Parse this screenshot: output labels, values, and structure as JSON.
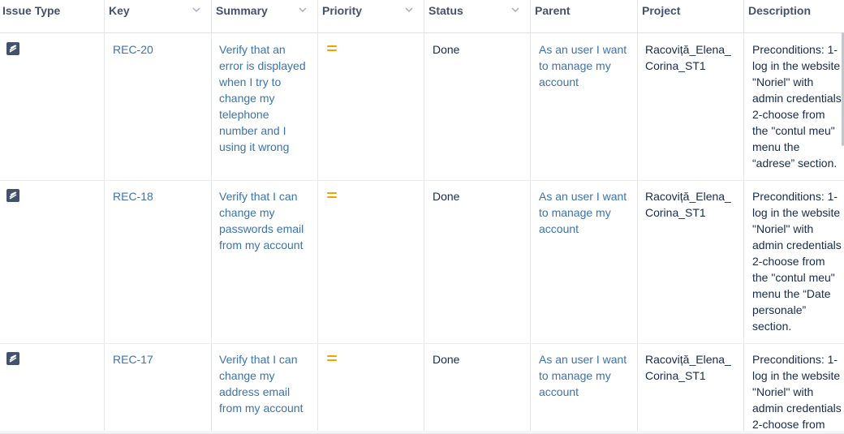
{
  "columns": [
    {
      "label": "Issue Type",
      "sortable": false
    },
    {
      "label": "Key",
      "sortable": true
    },
    {
      "label": "Summary",
      "sortable": true
    },
    {
      "label": "Priority",
      "sortable": true
    },
    {
      "label": "Status",
      "sortable": true
    },
    {
      "label": "Parent",
      "sortable": false
    },
    {
      "label": "Project",
      "sortable": false
    },
    {
      "label": "Description",
      "sortable": false
    }
  ],
  "rows": [
    {
      "issue_type_icon": "story-icon",
      "key": "REC-20",
      "summary": [
        "Verify that an",
        "error is displayed",
        "when I try to",
        "change my",
        "telephone",
        "number and I",
        "using it wrong"
      ],
      "priority_icon": "priority-medium-icon",
      "status": "Done",
      "parent": [
        "As an user I want",
        "to manage my",
        "account"
      ],
      "project": [
        "Racoviță_Elena_",
        "Corina_ST1"
      ],
      "description": [
        "Preconditions: 1-",
        "log in the website",
        "\"Noriel\" with",
        "admin credentials",
        "2-choose from",
        "the \"contul meu\"",
        "menu the",
        "“adrese” section."
      ]
    },
    {
      "issue_type_icon": "story-icon",
      "key": "REC-18",
      "summary": [
        "Verify that I can",
        "change my",
        "passwords email",
        "from my account"
      ],
      "priority_icon": "priority-medium-icon",
      "status": "Done",
      "parent": [
        "As an user I want",
        "to manage my",
        "account"
      ],
      "project": [
        "Racoviță_Elena_",
        "Corina_ST1"
      ],
      "description": [
        "Preconditions: 1-",
        "log in the website",
        "\"Noriel\" with",
        "admin credentials",
        "2-choose from",
        "the \"contul meu\"",
        "menu the “Date",
        "personale”",
        "section."
      ]
    },
    {
      "issue_type_icon": "story-icon",
      "key": "REC-17",
      "summary": [
        "Verify that I can",
        "change my",
        "address email",
        "from my account"
      ],
      "priority_icon": "priority-medium-icon",
      "status": "Done",
      "parent": [
        "As an user I want",
        "to manage my",
        "account"
      ],
      "project": [
        "Racoviță_Elena_",
        "Corina_ST1"
      ],
      "description": [
        "Preconditions: 1-",
        "log in the website",
        "\"Noriel\" with",
        "admin credentials",
        "2-choose from"
      ]
    }
  ],
  "colors": {
    "link": "#3b73af",
    "priority": "#f0a400",
    "icon": "#42526e"
  }
}
